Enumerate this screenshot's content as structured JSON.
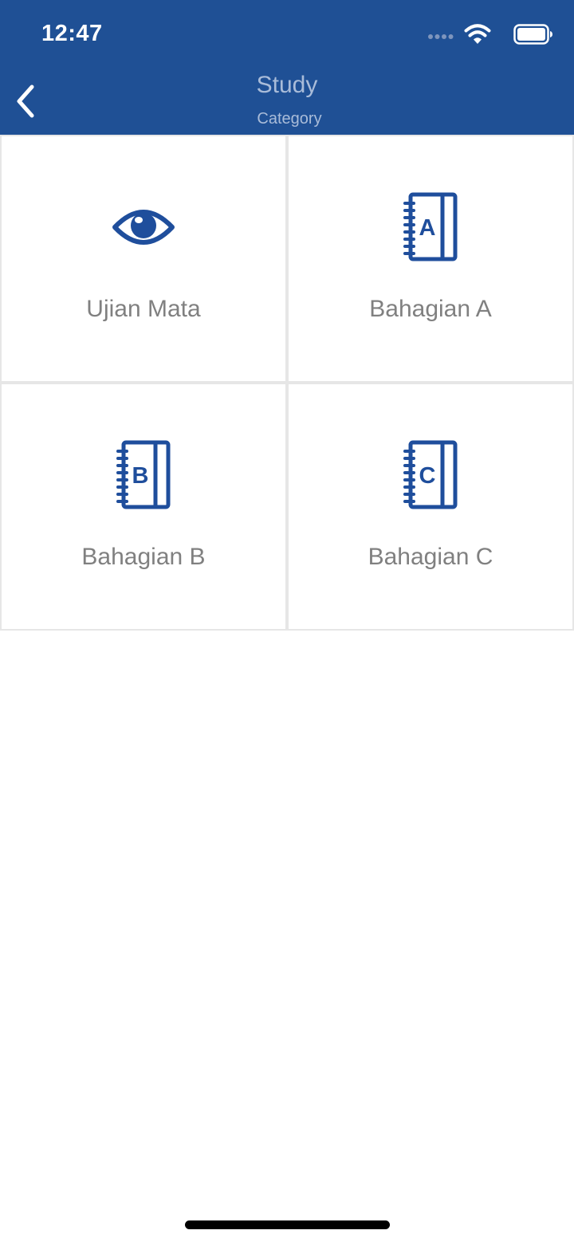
{
  "status_bar": {
    "time": "12:47",
    "icons": [
      "cellular-signal-icon",
      "wifi-icon",
      "battery-icon"
    ]
  },
  "header": {
    "title": "Study",
    "subtitle": "Category",
    "back_icon": "chevron-left-icon",
    "background_color": "#1F5095"
  },
  "categories": [
    {
      "label": "Ujian Mata",
      "icon": "eye-icon"
    },
    {
      "label": "Bahagian A",
      "icon": "notebook-a-icon",
      "letter": "A"
    },
    {
      "label": "Bahagian B",
      "icon": "notebook-b-icon",
      "letter": "B"
    },
    {
      "label": "Bahagian C",
      "icon": "notebook-c-icon",
      "letter": "C"
    }
  ],
  "colors": {
    "accent": "#1F4E9C",
    "label": "#808080"
  }
}
